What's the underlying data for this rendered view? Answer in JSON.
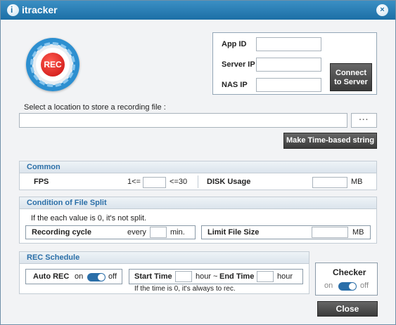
{
  "window": {
    "title": "itracker",
    "app_icon_glyph": "i",
    "close_glyph": "×"
  },
  "rec_button": {
    "label": "REC"
  },
  "connection": {
    "app_id_label": "App ID",
    "server_ip_label": "Server IP",
    "nas_ip_label": "NAS IP",
    "app_id_value": "",
    "server_ip_value": "",
    "nas_ip_value": "",
    "connect_line1": "Connect",
    "connect_line2": "to Server"
  },
  "location": {
    "label": "Select a location to store a recording file :",
    "path_value": "",
    "browse_label": "···",
    "time_string_button": "Make Time-based string"
  },
  "common": {
    "title": "Common",
    "fps_label": "FPS",
    "fps_min": "1<=",
    "fps_max": "<=30",
    "fps_value": "",
    "disk_label": "DISK Usage",
    "disk_unit": "MB",
    "disk_value": ""
  },
  "file_split": {
    "title": "Condition of File Split",
    "note": "If the each value is 0, it's not split.",
    "cycle_label": "Recording cycle",
    "cycle_every": "every",
    "cycle_unit": "min.",
    "cycle_value": "",
    "limit_label": "Limit File Size",
    "limit_unit": "MB",
    "limit_value": ""
  },
  "schedule": {
    "title": "REC Schedule",
    "auto_rec_label": "Auto REC",
    "on_label": "on",
    "off_label": "off",
    "auto_rec_state": "on",
    "start_label": "Start Time",
    "hour1": "hour",
    "tilde": "~",
    "end_label": "End Time",
    "hour2": "hour",
    "note": "If the time is 0, it's always to rec."
  },
  "checker": {
    "title": "Checker",
    "on_label": "on",
    "off_label": "off",
    "state": "on"
  },
  "close_button": "Close"
}
